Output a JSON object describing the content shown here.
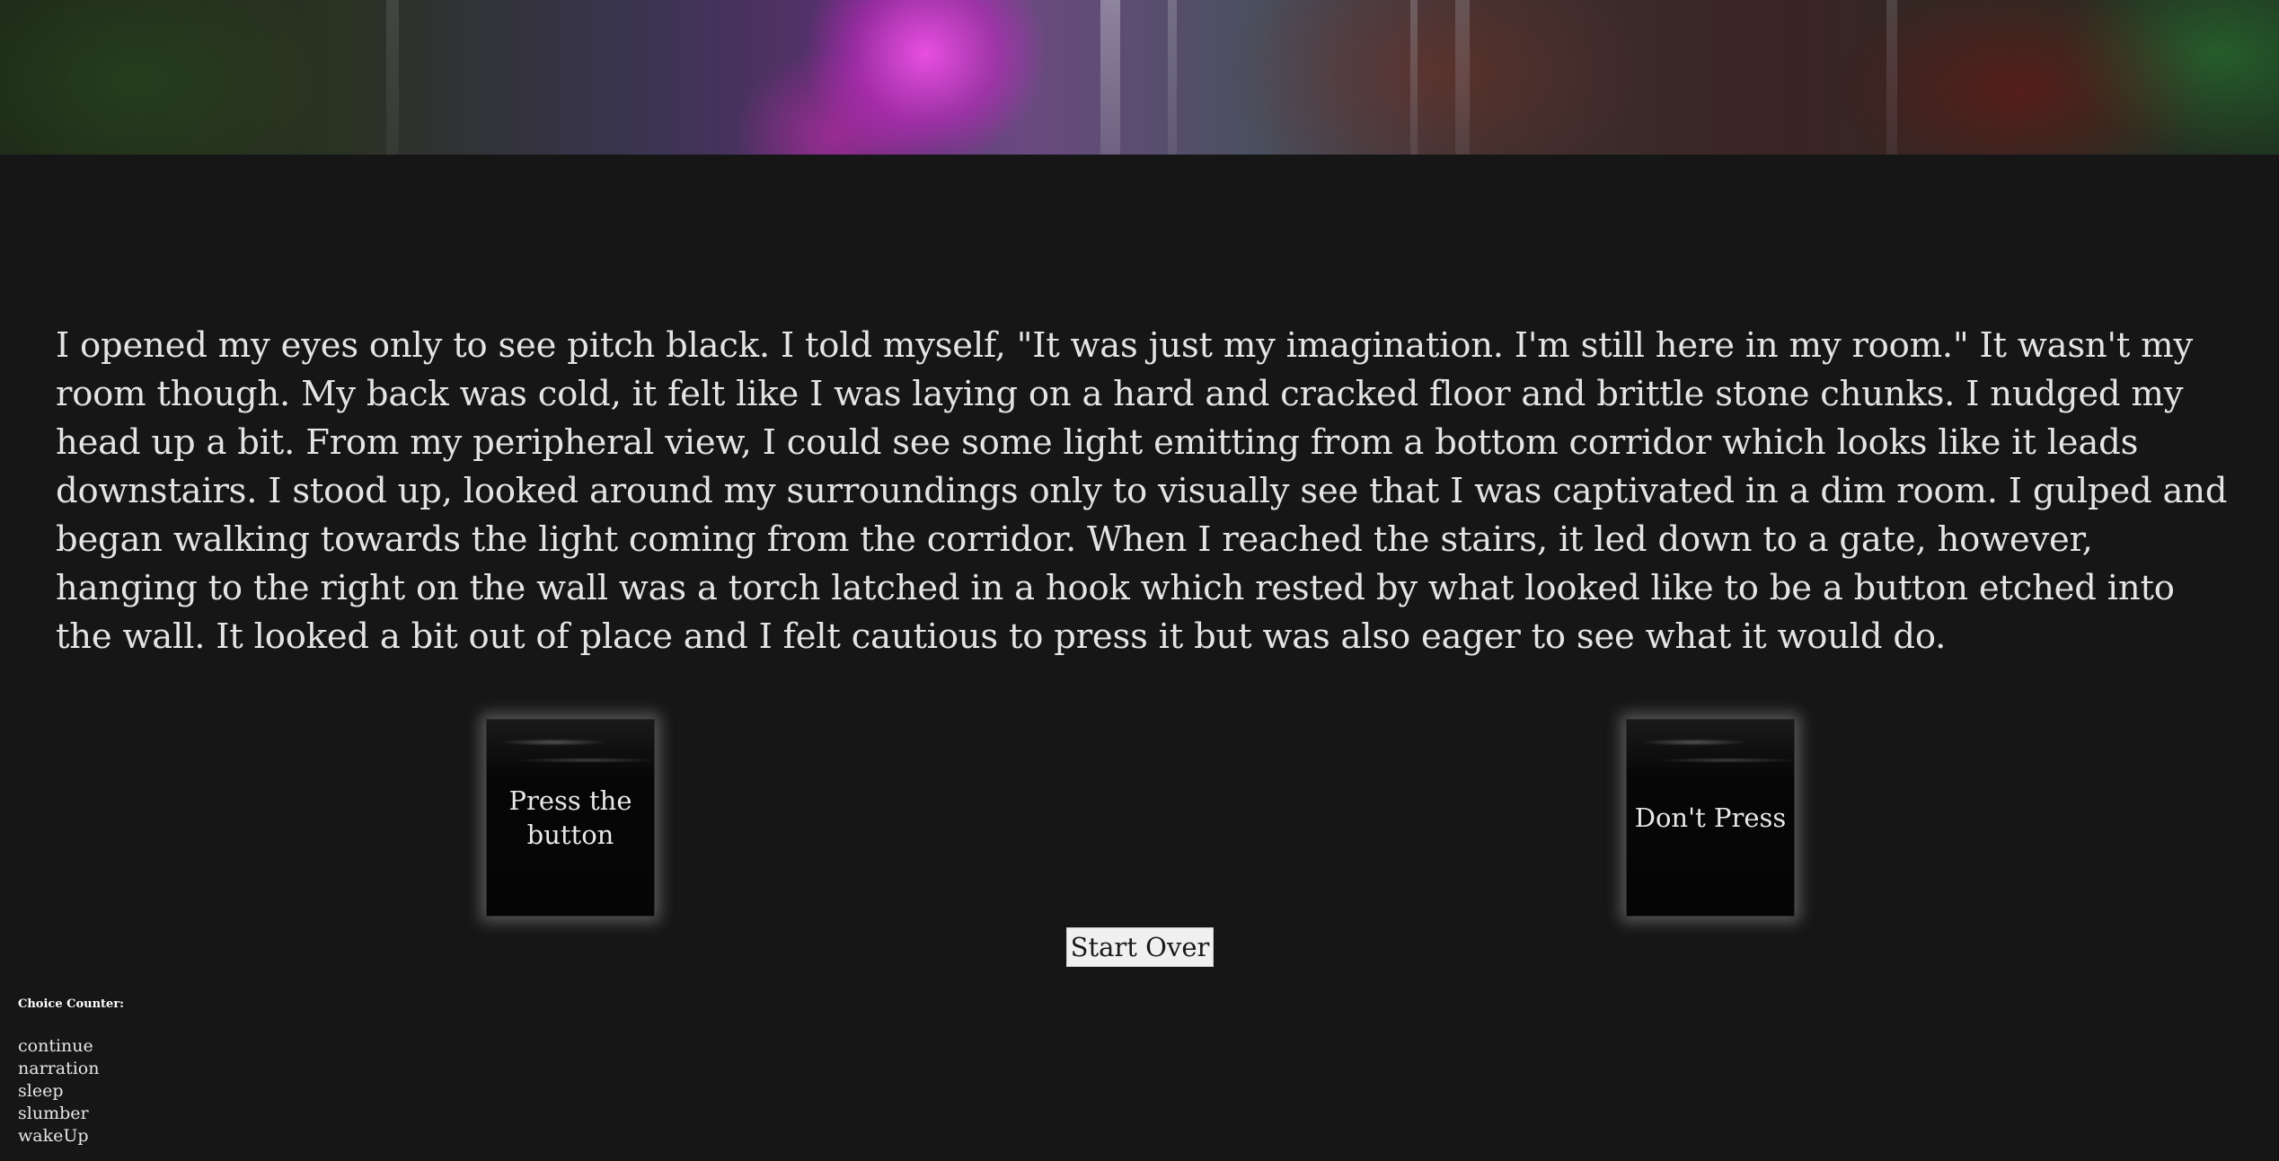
{
  "banner": {
    "icon": "forest-banner-image"
  },
  "story": {
    "text": "I opened my eyes only to see pitch black. I told myself, \"It was just my imagination. I'm still here in my room.\" It wasn't my room though. My back was cold, it felt like I was laying on a hard and cracked floor and brittle stone chunks. I nudged my head up a bit. From my peripheral view, I could see some light emitting from a bottom corridor which looks like it leads downstairs. I stood up, looked around my surroundings only to visually see that I was captivated in a dim room. I gulped and began walking towards the light coming from the corridor. When I reached the stairs, it led down to a gate, however, hanging to the right on the wall was a torch latched in a hook which rested by what looked like to be a button etched into the wall. It looked a bit out of place and I felt cautious to press it but was also eager to see what it would do."
  },
  "choices": {
    "first": "Press the button",
    "second": "Don't Press"
  },
  "start_over_label": "Start Over",
  "counter": {
    "title": "Choice Counter:",
    "items": [
      "continue",
      "narration",
      "sleep",
      "slumber",
      "wakeUp"
    ]
  },
  "colors": {
    "background": "#161616",
    "text": "#e4e4e4"
  }
}
